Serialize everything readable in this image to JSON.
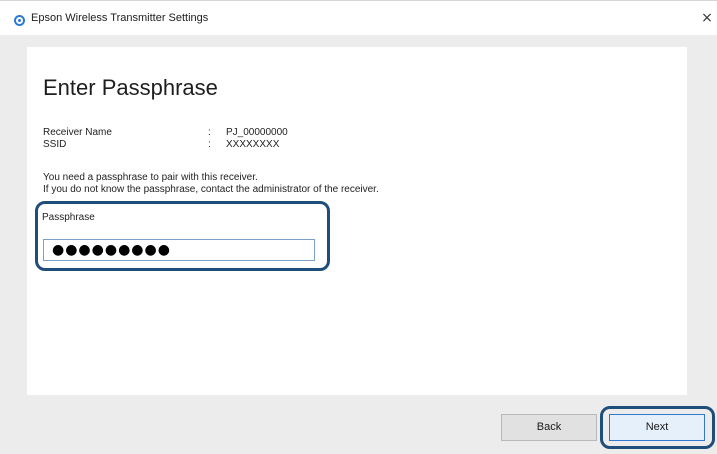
{
  "window": {
    "title": "Epson Wireless Transmitter Settings",
    "close_glyph": "×"
  },
  "page": {
    "heading": "Enter Passphrase",
    "info": [
      {
        "label": "Receiver Name",
        "separator": ":",
        "value": "PJ_00000000"
      },
      {
        "label": "SSID",
        "separator": ":",
        "value": "XXXXXXXX"
      }
    ],
    "note_line_1": "You need a passphrase to pair with this receiver.",
    "note_line_2": "If you do not know the passphrase, contact the administrator of the receiver."
  },
  "passphrase": {
    "label": "Passphrase",
    "masked_value": "●●●●●●●●●"
  },
  "buttons": {
    "back_label": "Back",
    "next_label": "Next"
  },
  "colors": {
    "highlight": "#1f4e7a",
    "app_icon": "#2c7bd3"
  },
  "icons": {
    "app": "epson-app-icon",
    "close": "close-icon"
  }
}
